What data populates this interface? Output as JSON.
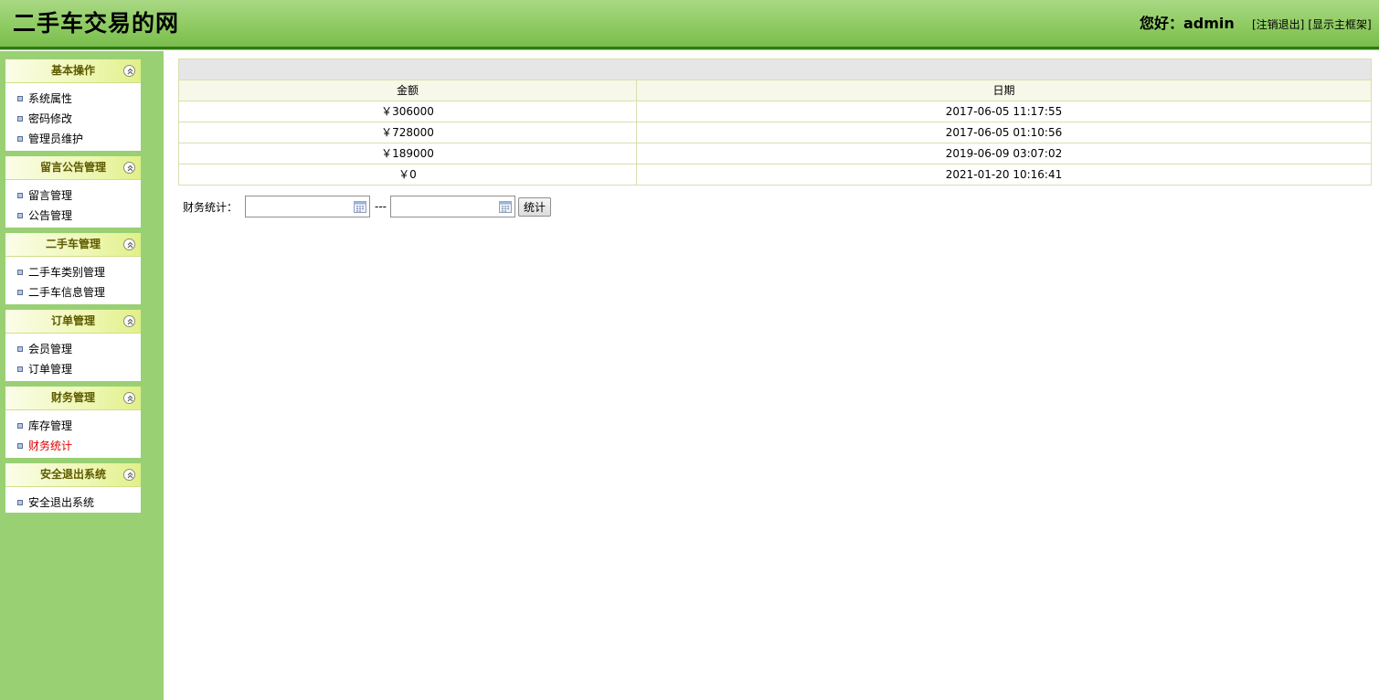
{
  "header": {
    "title": "二手车交易的网",
    "greeting": "您好：admin",
    "logout_link": "[注销退出]",
    "frame_link": "[显示主框架]"
  },
  "sidebar": {
    "groups": [
      {
        "title": "基本操作",
        "items": [
          "系统属性",
          "密码修改",
          "管理员维护"
        ]
      },
      {
        "title": "留言公告管理",
        "items": [
          "留言管理",
          "公告管理"
        ]
      },
      {
        "title": "二手车管理",
        "items": [
          "二手车类别管理",
          "二手车信息管理"
        ]
      },
      {
        "title": "订单管理",
        "items": [
          "会员管理",
          "订单管理"
        ]
      },
      {
        "title": "财务管理",
        "items": [
          "库存管理",
          "财务统计"
        ]
      },
      {
        "title": "安全退出系统",
        "items": [
          "安全退出系统"
        ]
      }
    ],
    "active_item": "财务统计"
  },
  "table": {
    "headers": [
      "金额",
      "日期"
    ],
    "rows": [
      [
        "￥306000",
        "2017-06-05 11:17:55"
      ],
      [
        "￥728000",
        "2017-06-05 01:10:56"
      ],
      [
        "￥189000",
        "2019-06-09 03:07:02"
      ],
      [
        "￥0",
        "2021-01-20 10:16:41"
      ]
    ]
  },
  "filter": {
    "label": "财务统计：",
    "start_date": "",
    "end_date": "",
    "separator": "---",
    "button_label": "统计"
  },
  "colors": {
    "header_green": "#8fcb63",
    "header_line": "#2e7b12",
    "sidebar_bg": "#9ad074",
    "active_item": "#e20000",
    "table_border": "#d6e0b1"
  }
}
